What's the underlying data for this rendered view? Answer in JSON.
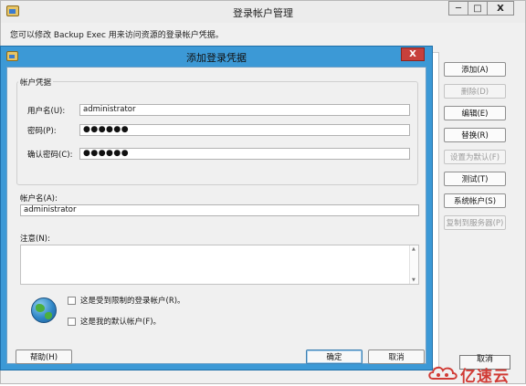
{
  "main_window": {
    "title": "登录帐户管理",
    "description": "您可以修改 Backup Exec 用来访问资源的登录帐户凭据。",
    "window_buttons": {
      "minimize": "─",
      "maximize": "□",
      "close": "X"
    },
    "side_buttons": [
      {
        "label": "添加(A)",
        "enabled": true
      },
      {
        "label": "删除(D)",
        "enabled": false
      },
      {
        "label": "编辑(E)",
        "enabled": true
      },
      {
        "label": "替换(R)",
        "enabled": true
      },
      {
        "label": "设置为默认(F)",
        "enabled": false
      },
      {
        "label": "测试(T)",
        "enabled": true
      },
      {
        "label": "系统帐户(S)",
        "enabled": true
      },
      {
        "label": "复制到服务器(P)",
        "enabled": false
      }
    ],
    "close_button": "取消"
  },
  "dialog": {
    "title": "添加登录凭据",
    "close_glyph": "X",
    "credentials_group": {
      "legend": "帐户凭据",
      "username_label": "用户名(U):",
      "username_value": "administrator",
      "password_label": "密码(P):",
      "password_value": "●●●●●●",
      "confirm_label": "确认密码(C):",
      "confirm_value": "●●●●●●"
    },
    "account_name_label": "帐户名(A):",
    "account_name_value": "administrator",
    "notes_label": "注意(N):",
    "notes_value": "",
    "restricted_checkbox": {
      "label": "这是受到限制的登录帐户(R)。",
      "checked": false
    },
    "default_checkbox": {
      "label": "这是我的默认帐户(F)。",
      "checked": false
    },
    "help_button": "帮助(H)",
    "ok_button": "确定",
    "cancel_button": "取消"
  },
  "watermark": {
    "text": "亿速云"
  }
}
